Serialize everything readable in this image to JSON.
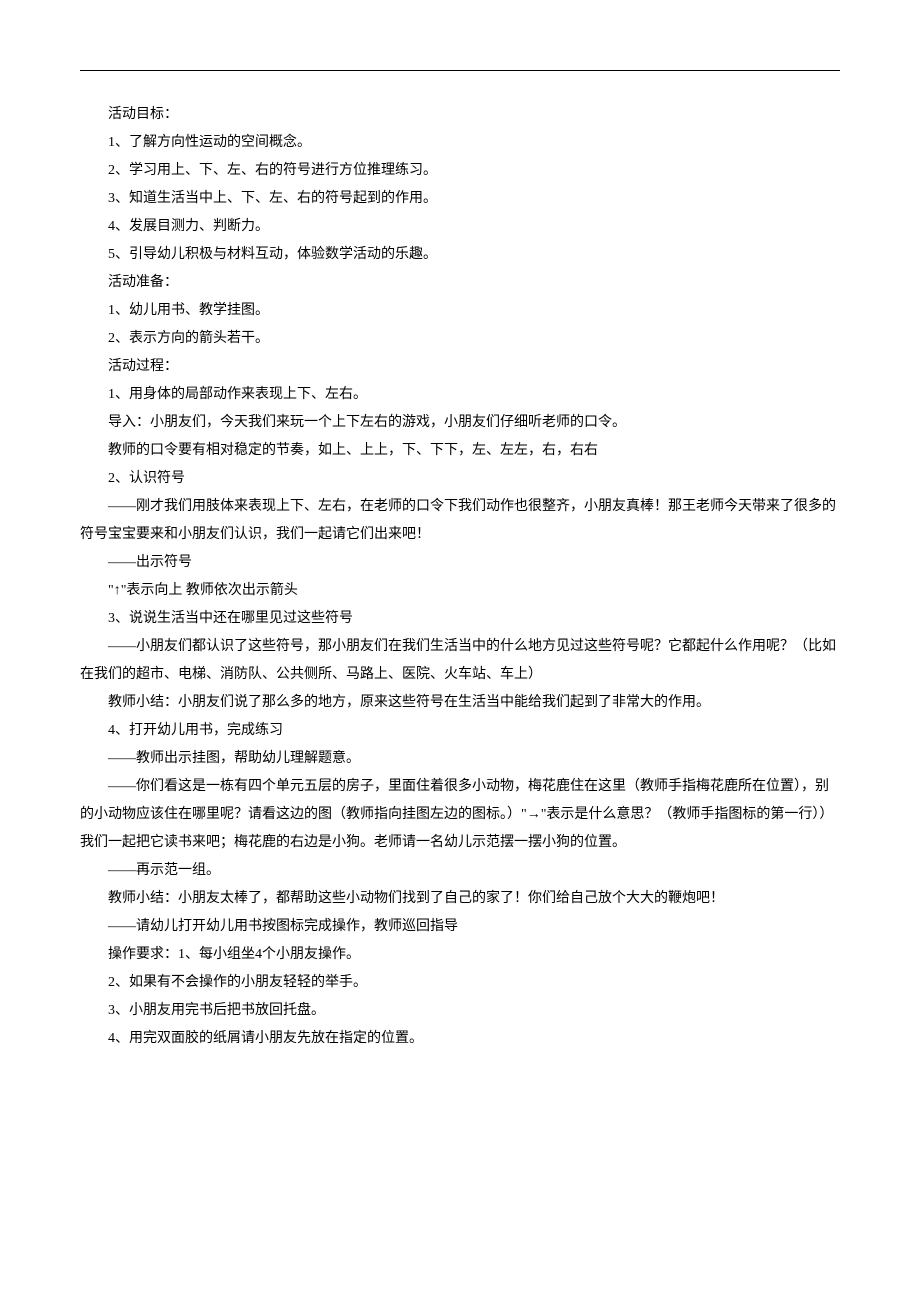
{
  "lines": [
    {
      "text": "活动目标：",
      "indent": true
    },
    {
      "text": "1、了解方向性运动的空间概念。",
      "indent": true
    },
    {
      "text": "2、学习用上、下、左、右的符号进行方位推理练习。",
      "indent": true
    },
    {
      "text": "3、知道生活当中上、下、左、右的符号起到的作用。",
      "indent": true
    },
    {
      "text": "4、发展目测力、判断力。",
      "indent": true
    },
    {
      "text": "5、引导幼儿积极与材料互动，体验数学活动的乐趣。",
      "indent": true
    },
    {
      "text": "活动准备：",
      "indent": true
    },
    {
      "text": "1、幼儿用书、教学挂图。",
      "indent": true
    },
    {
      "text": "2、表示方向的箭头若干。",
      "indent": true
    },
    {
      "text": "活动过程：",
      "indent": true
    },
    {
      "text": "1、用身体的局部动作来表现上下、左右。",
      "indent": true
    },
    {
      "text": "导入：小朋友们，今天我们来玩一个上下左右的游戏，小朋友们仔细听老师的口令。",
      "indent": true
    },
    {
      "text": "教师的口令要有相对稳定的节奏，如上、上上，下、下下，左、左左，右，右右",
      "indent": true
    },
    {
      "text": "2、认识符号",
      "indent": true
    },
    {
      "text": "——刚才我们用肢体来表现上下、左右，在老师的口令下我们动作也很整齐，小朋友真棒！那王老师今天带来了很多的符号宝宝要来和小朋友们认识，我们一起请它们出来吧！",
      "indent": true,
      "wrap": true
    },
    {
      "text": "——出示符号",
      "indent": true
    },
    {
      "text": "\"↑\"表示向上  教师依次出示箭头",
      "indent": true
    },
    {
      "text": "3、说说生活当中还在哪里见过这些符号",
      "indent": true
    },
    {
      "text": "——小朋友们都认识了这些符号，那小朋友们在我们生活当中的什么地方见过这些符号呢？它都起什么作用呢？（比如在我们的超市、电梯、消防队、公共侧所、马路上、医院、火车站、车上）",
      "indent": true,
      "wrap": true
    },
    {
      "text": "教师小结：小朋友们说了那么多的地方，原来这些符号在生活当中能给我们起到了非常大的作用。",
      "indent": true
    },
    {
      "text": "4、打开幼儿用书，完成练习",
      "indent": true
    },
    {
      "text": "——教师出示挂图，帮助幼儿理解题意。",
      "indent": true
    },
    {
      "text": "——你们看这是一栋有四个单元五层的房子，里面住着很多小动物，梅花鹿住在这里（教师手指梅花鹿所在位置），别的小动物应该住在哪里呢？请看这边的图（教师指向挂图左边的图标。）\"→\"表示是什么意思？（教师手指图标的第一行））我们一起把它读书来吧；梅花鹿的右边是小狗。老师请一名幼儿示范摆一摆小狗的位置。",
      "indent": true,
      "wrap": true
    },
    {
      "text": "——再示范一组。",
      "indent": true
    },
    {
      "text": "教师小结：小朋友太棒了，都帮助这些小动物们找到了自己的家了！你们给自己放个大大的鞭炮吧！",
      "indent": true
    },
    {
      "text": "——请幼儿打开幼儿用书按图标完成操作，教师巡回指导",
      "indent": true
    },
    {
      "text": "操作要求：1、每小组坐4个小朋友操作。",
      "indent": true
    },
    {
      "text": "2、如果有不会操作的小朋友轻轻的举手。",
      "indent": true
    },
    {
      "text": "3、小朋友用完书后把书放回托盘。",
      "indent": true
    },
    {
      "text": "4、用完双面胶的纸屑请小朋友先放在指定的位置。",
      "indent": true
    }
  ]
}
